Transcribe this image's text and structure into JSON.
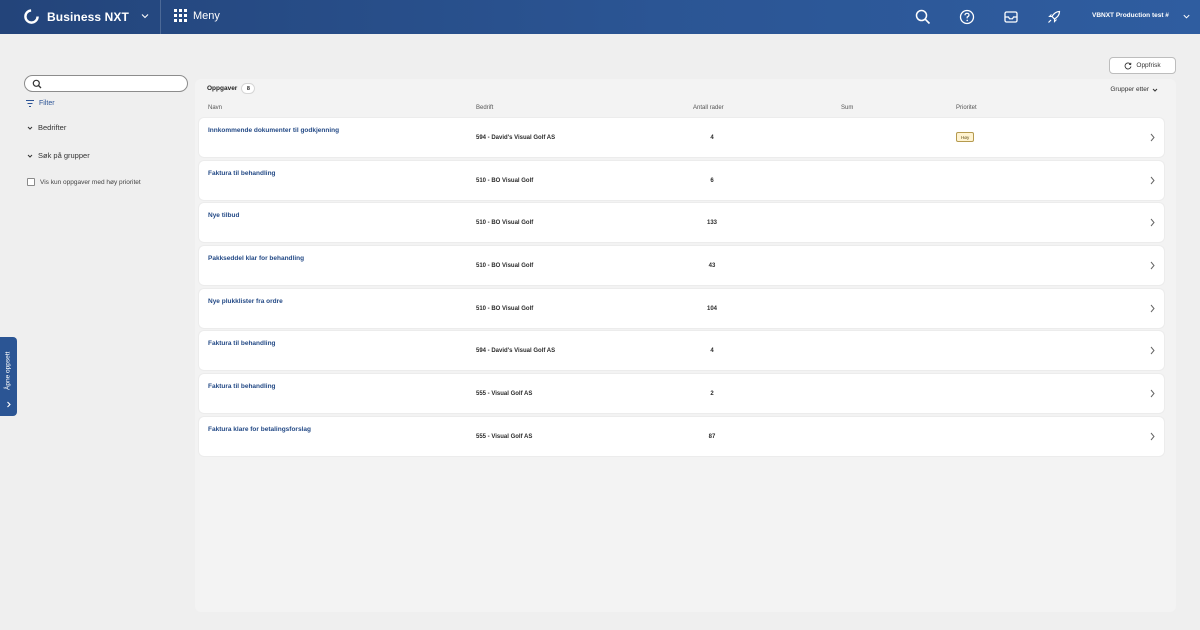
{
  "topbar": {
    "brand_name": "Business NXT",
    "menu_label": "Meny",
    "company_selector": "VBNXT Production test #",
    "icons": [
      "search-icon",
      "help-icon",
      "inbox-icon",
      "rocket-icon"
    ]
  },
  "filters": {
    "search_placeholder": "",
    "filter_label": "Filter",
    "companies_label": "Bedrifter",
    "groups_label": "Søk på grupper",
    "high_priority_label": "Vis kun oppgaver med høy prioritet",
    "high_priority_checked": false
  },
  "side_tab": {
    "label": "Åpne oppsett"
  },
  "toolbar": {
    "refresh_label": "Oppfrisk",
    "group_by_label": "Grupper etter"
  },
  "tasks": {
    "title": "Oppgaver",
    "count": "8",
    "columns": {
      "name": "Navn",
      "company": "Bedrift",
      "rows": "Antall rader",
      "sum": "Sum",
      "priority": "Prioritet"
    },
    "rows": [
      {
        "name": "Innkommende dokumenter til godkjenning",
        "company": "594 - David's Visual Golf AS",
        "count": "4",
        "sum": "",
        "priority": "Høy"
      },
      {
        "name": "Faktura til behandling",
        "company": "510 - BO Visual Golf",
        "count": "6",
        "sum": "",
        "priority": ""
      },
      {
        "name": "Nye tilbud",
        "company": "510 - BO Visual Golf",
        "count": "133",
        "sum": "",
        "priority": ""
      },
      {
        "name": "Pakkseddel klar for behandling",
        "company": "510 - BO Visual Golf",
        "count": "43",
        "sum": "",
        "priority": ""
      },
      {
        "name": "Nye plukklister fra ordre",
        "company": "510 - BO Visual Golf",
        "count": "104",
        "sum": "",
        "priority": ""
      },
      {
        "name": "Faktura til behandling",
        "company": "594 - David's Visual Golf AS",
        "count": "4",
        "sum": "",
        "priority": ""
      },
      {
        "name": "Faktura til behandling",
        "company": "555 - Visual Golf AS",
        "count": "2",
        "sum": "",
        "priority": ""
      },
      {
        "name": "Faktura klare for betalingsforslag",
        "company": "555 - Visual Golf AS",
        "count": "87",
        "sum": "",
        "priority": ""
      }
    ]
  },
  "colors": {
    "topbar": "#2b5594",
    "accent": "#2c5496",
    "priority_badge": "#fff3d1",
    "background": "#efefef"
  }
}
